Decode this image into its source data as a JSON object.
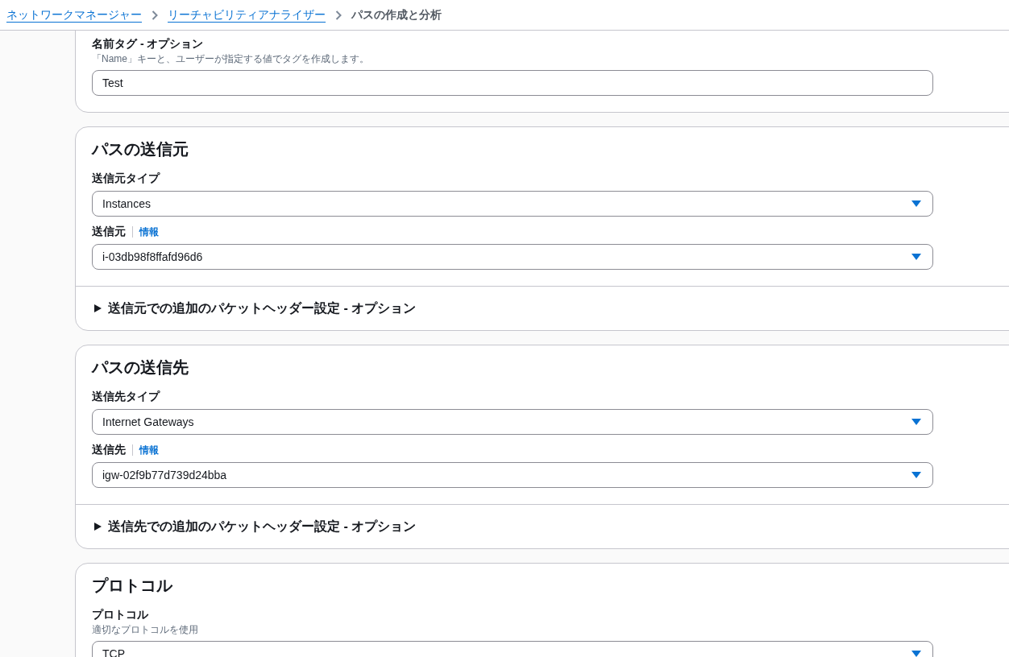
{
  "breadcrumbs": [
    {
      "label": "ネットワークマネージャー",
      "kind": "link"
    },
    {
      "label": "リーチャビリティアナライザー",
      "kind": "link"
    },
    {
      "label": "パスの作成と分析",
      "kind": "current"
    }
  ],
  "sections": [
    {
      "fields": [
        {
          "label": "名前タグ - オプション",
          "description": "「Name」キーと、ユーザーが指定する値でタグを作成します。",
          "kind": "text",
          "value": "Test"
        }
      ]
    },
    {
      "title": "パスの送信元",
      "fields": [
        {
          "label": "送信元タイプ",
          "kind": "select",
          "value": "Instances"
        },
        {
          "label": "送信元",
          "info": "情報",
          "kind": "select",
          "value": "i-03db98f8ffafd96d6"
        }
      ],
      "expander": {
        "label": "送信元での追加のパケットヘッダー設定 - オプション",
        "expanded": false
      }
    },
    {
      "title": "パスの送信先",
      "fields": [
        {
          "label": "送信先タイプ",
          "kind": "select",
          "value": "Internet Gateways"
        },
        {
          "label": "送信先",
          "info": "情報",
          "kind": "select",
          "value": "igw-02f9b77d739d24bba"
        }
      ],
      "expander": {
        "label": "送信先での追加のパケットヘッダー設定 - オプション",
        "expanded": false
      }
    },
    {
      "title": "プロトコル",
      "fields": [
        {
          "label": "プロトコル",
          "description": "適切なプロトコルを使用",
          "kind": "select",
          "value": "TCP"
        }
      ]
    }
  ]
}
